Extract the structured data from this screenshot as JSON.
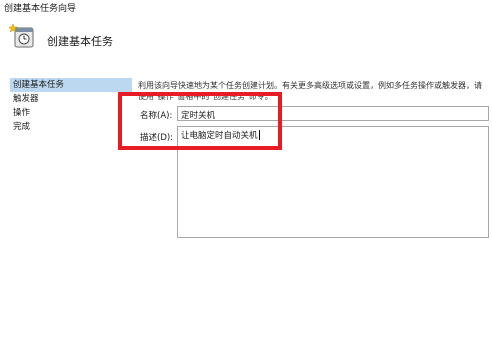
{
  "window": {
    "title": "创建基本任务向导"
  },
  "header": {
    "title": "创建基本任务",
    "icon": "task-scheduler-icon"
  },
  "sidebar": {
    "items": [
      {
        "label": "创建基本任务",
        "active": true
      },
      {
        "label": "触发器",
        "active": false
      },
      {
        "label": "操作",
        "active": false
      },
      {
        "label": "完成",
        "active": false
      }
    ]
  },
  "form": {
    "intro": "利用该向导快速地为某个任务创建计划。有关更多高级选项或设置，例如多任务操作或触发器，请使用\"操作\"窗格中的\"创建任务\"命令。",
    "name_label": "名称(A):",
    "name_value": "定时关机",
    "desc_label": "描述(D):",
    "desc_value": "让电脑定时自动关机"
  },
  "colors": {
    "highlight": "#e81c24",
    "nav_active": "#bcd8f0"
  }
}
